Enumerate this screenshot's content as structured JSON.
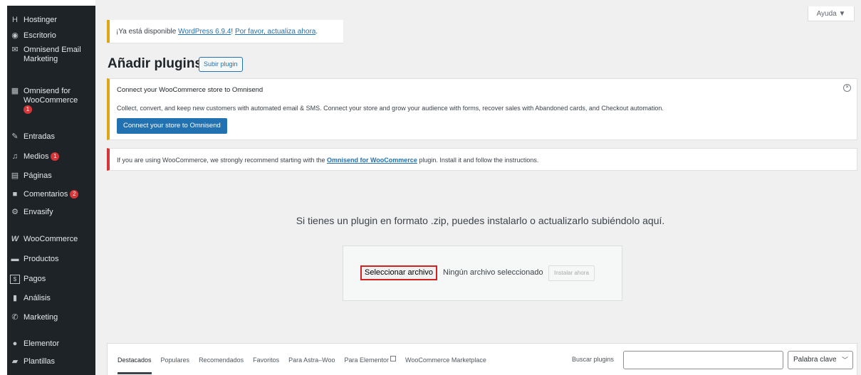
{
  "sidebar": {
    "items": [
      {
        "label": "Hostinger",
        "icon": "hostinger-icon",
        "glyph": "H",
        "badge": ""
      },
      {
        "label": "Escritorio",
        "icon": "dashboard-icon",
        "glyph": "◉",
        "badge": ""
      },
      {
        "label": "Omnisend Email Marketing",
        "icon": "envelope-icon",
        "glyph": "✉",
        "badge": ""
      },
      {
        "label": "Omnisend for WooCommerce",
        "icon": "store-icon",
        "glyph": "▦",
        "badge": ""
      },
      {
        "label": "Entradas",
        "icon": "pin-icon",
        "glyph": "✎",
        "badge": ""
      },
      {
        "label": "Medios",
        "icon": "media-icon",
        "glyph": "♫",
        "badge": "1"
      },
      {
        "label": "Páginas",
        "icon": "pages-icon",
        "glyph": "▤",
        "badge": ""
      },
      {
        "label": "Comentarios",
        "icon": "comments-icon",
        "glyph": "■",
        "badge": "2"
      },
      {
        "label": "Envasify",
        "icon": "envasify-icon",
        "glyph": "⚙",
        "badge": ""
      },
      {
        "label": "WooCommerce",
        "icon": "woocommerce-icon",
        "glyph": "W",
        "badge": ""
      },
      {
        "label": "Productos",
        "icon": "products-icon",
        "glyph": "▬",
        "badge": ""
      },
      {
        "label": "Pagos",
        "icon": "payments-icon",
        "glyph": "$",
        "badge": ""
      },
      {
        "label": "Análisis",
        "icon": "analytics-icon",
        "glyph": "▮",
        "badge": ""
      },
      {
        "label": "Marketing",
        "icon": "megaphone-icon",
        "glyph": "✆",
        "badge": ""
      },
      {
        "label": "Elementor",
        "icon": "elementor-icon",
        "glyph": "●",
        "badge": ""
      },
      {
        "label": "Plantillas",
        "icon": "folder-icon",
        "glyph": "▰",
        "badge": ""
      }
    ],
    "omnisend_woo_badge": "1"
  },
  "header": {
    "help_label": "Ayuda ▼"
  },
  "update_notice": {
    "prefix": "¡Ya está disponible ",
    "link1": "WordPress 6.9.4",
    "middle": "! ",
    "link2": "Por favor, actualiza ahora",
    "suffix": "."
  },
  "page": {
    "title": "Añadir plugins",
    "upload_button": "Subir plugin"
  },
  "omnisend_notice": {
    "title": "Connect your WooCommerce store to Omnisend",
    "description": "Collect, convert, and keep new customers with automated email & SMS. Connect your store and grow your audience with forms, recover sales with Abandoned cards, and Checkout automation.",
    "button": "Connect your store to Omnisend"
  },
  "woo_notice": {
    "prefix": "If you are using WooCommerce, we strongly recommend starting with the ",
    "link": "Omnisend for WooCommerce",
    "suffix": " plugin. Install it and follow the instructions."
  },
  "upload": {
    "help_text": "Si tienes un plugin en formato .zip, puedes instalarlo o actualizarlo subiéndolo aquí.",
    "choose_file": "Seleccionar archivo",
    "no_file": "Ningún archivo seleccionado",
    "install_now": "Instalar ahora"
  },
  "filter": {
    "tabs": [
      "Destacados",
      "Populares",
      "Recomendados",
      "Favoritos",
      "Para Astra–Woo",
      "Para Elementor",
      "WooCommerce Marketplace"
    ],
    "search_label": "Buscar plugins",
    "search_value": "",
    "search_type": "Palabra clave"
  }
}
